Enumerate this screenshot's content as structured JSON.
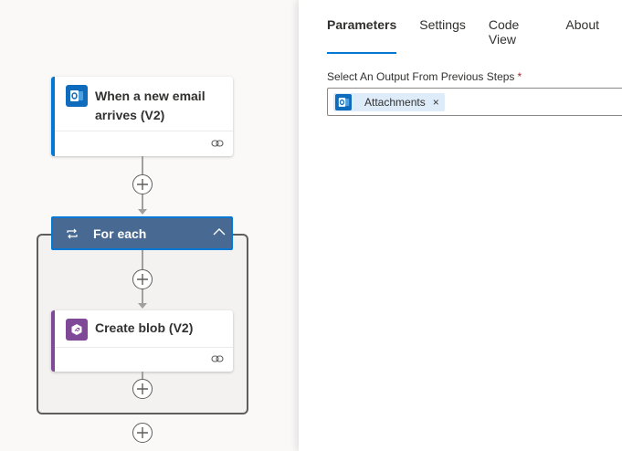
{
  "canvas": {
    "trigger": {
      "title_line1": "When a new email",
      "title_line2": "arrives (V2)",
      "icon": "outlook-icon",
      "accent_color": "#0078d4"
    },
    "foreach": {
      "title": "For each",
      "header_color": "#486991"
    },
    "create_blob": {
      "title": "Create blob (V2)",
      "icon": "blob-storage-icon",
      "accent_color": "#804998"
    },
    "add_buttons": [
      "add-step",
      "add-step",
      "add-step",
      "add-step"
    ]
  },
  "panel": {
    "tabs": [
      {
        "label": "Parameters",
        "active": true
      },
      {
        "label": "Settings",
        "active": false
      },
      {
        "label": "Code View",
        "active": false
      },
      {
        "label": "About",
        "active": false
      }
    ],
    "field": {
      "label": "Select An Output From Previous Steps",
      "required_marker": "*",
      "token": {
        "label": "Attachments",
        "remove": "×",
        "icon": "outlook-icon"
      }
    }
  }
}
